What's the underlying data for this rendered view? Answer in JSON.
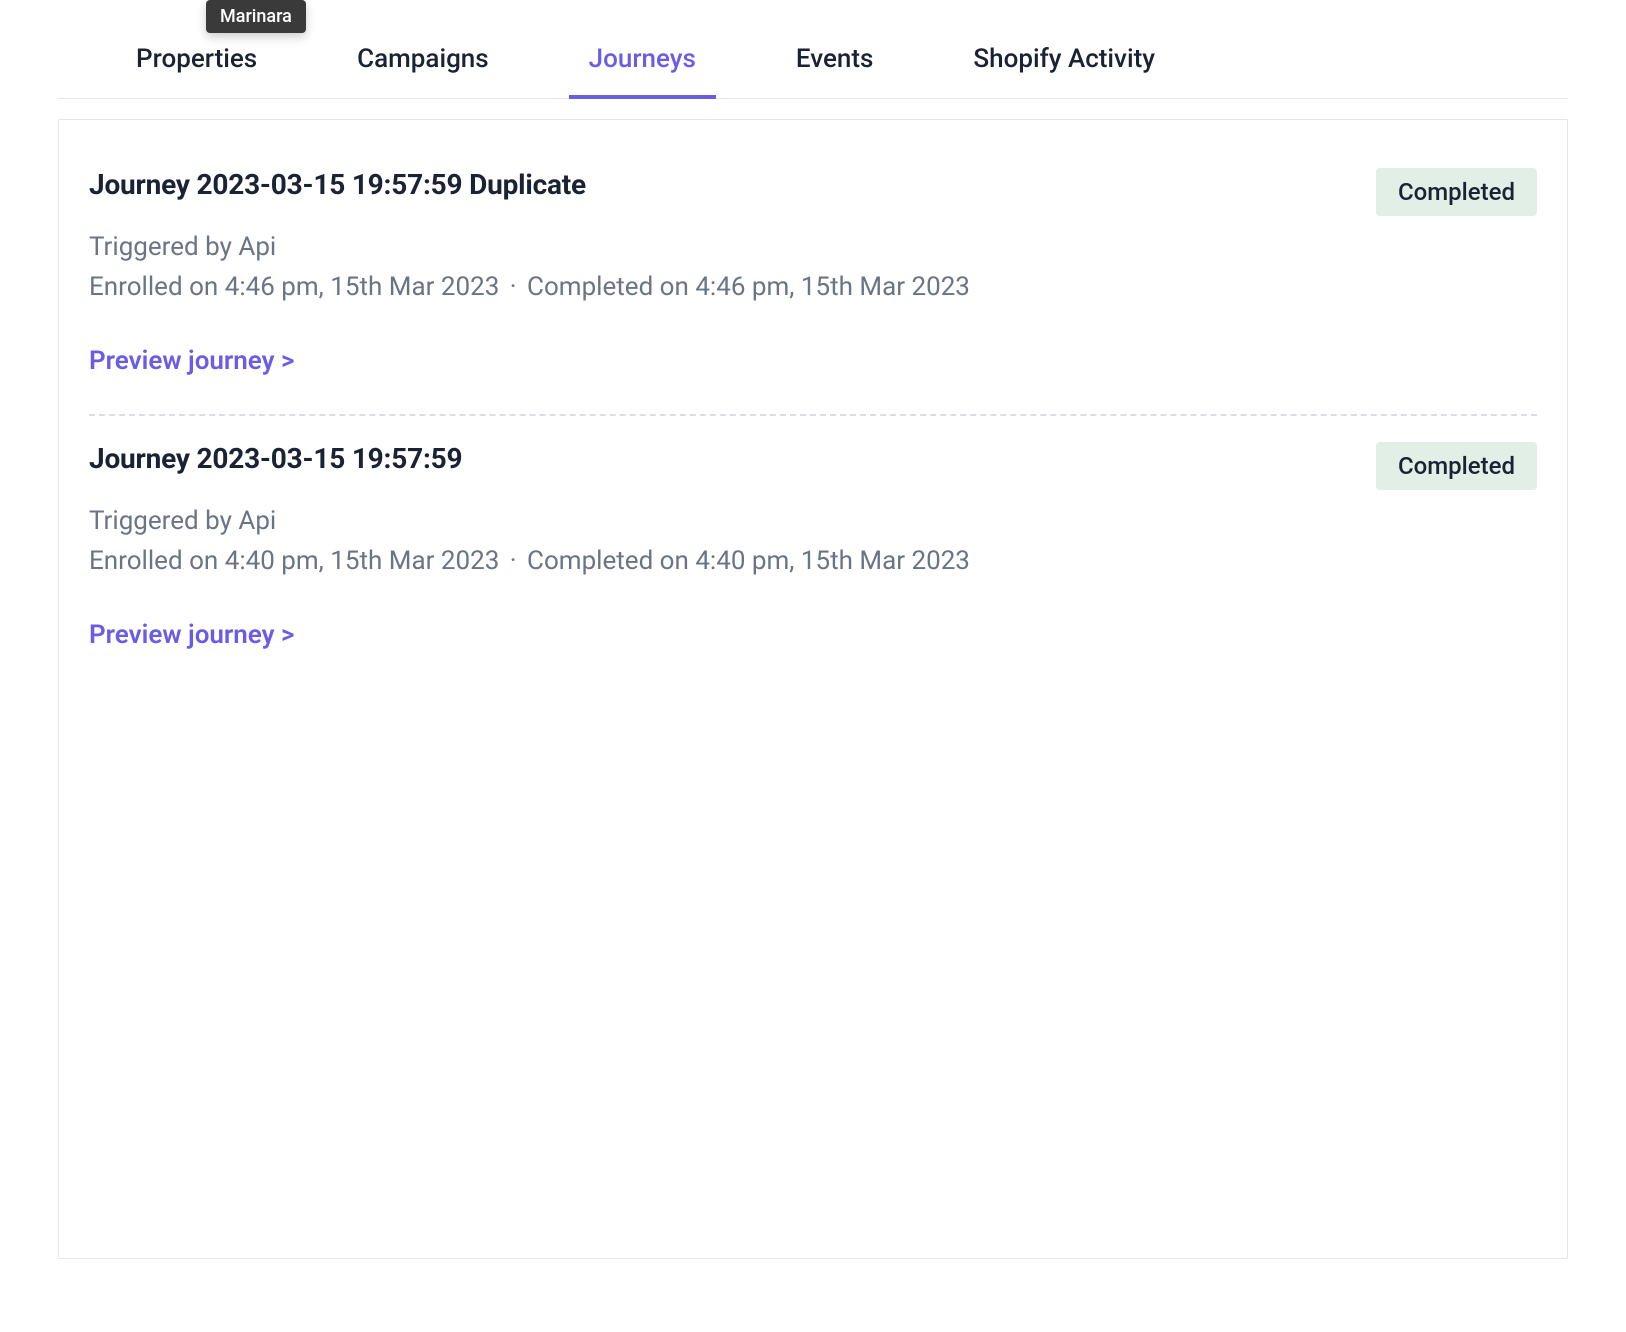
{
  "tooltip": "Marinara",
  "tabs": [
    {
      "label": "Properties",
      "active": false
    },
    {
      "label": "Campaigns",
      "active": false
    },
    {
      "label": "Journeys",
      "active": true
    },
    {
      "label": "Events",
      "active": false
    },
    {
      "label": "Shopify Activity",
      "active": false
    }
  ],
  "journeys": [
    {
      "title": "Journey 2023-03-15 19:57:59 Duplicate",
      "status": "Completed",
      "trigger": "Triggered by Api",
      "enrolled": "Enrolled on 4:46 pm, 15th Mar 2023",
      "completed": "Completed on 4:46 pm, 15th Mar 2023",
      "preview_label": "Preview journey >"
    },
    {
      "title": "Journey 2023-03-15 19:57:59",
      "status": "Completed",
      "trigger": "Triggered by Api",
      "enrolled": "Enrolled on 4:40 pm, 15th Mar 2023",
      "completed": "Completed on 4:40 pm, 15th Mar 2023",
      "preview_label": "Preview journey >"
    }
  ],
  "separator": "·"
}
